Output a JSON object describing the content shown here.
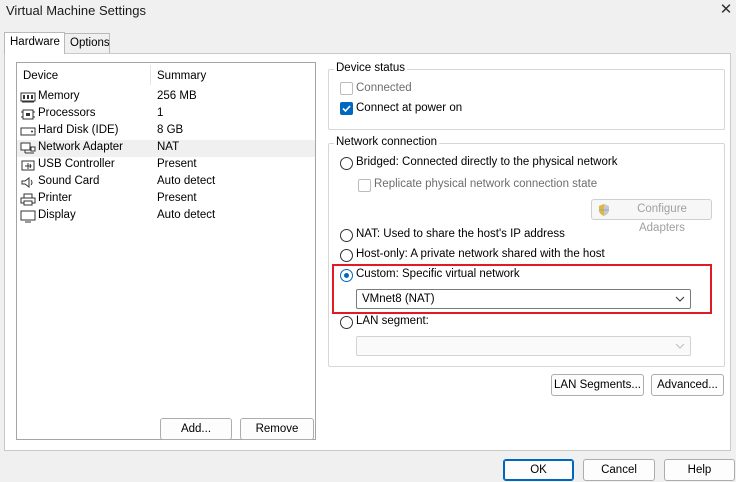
{
  "window": {
    "title": "Virtual Machine Settings"
  },
  "tabs": [
    {
      "label": "Hardware",
      "active": true
    },
    {
      "label": "Options",
      "active": false
    }
  ],
  "device_list": {
    "header_device": "Device",
    "header_summary": "Summary",
    "rows": [
      {
        "name": "Memory",
        "summary": "256 MB",
        "icon": "memory-icon"
      },
      {
        "name": "Processors",
        "summary": "1",
        "icon": "processor-icon"
      },
      {
        "name": "Hard Disk (IDE)",
        "summary": "8 GB",
        "icon": "hard-disk-icon"
      },
      {
        "name": "Network Adapter",
        "summary": "NAT",
        "icon": "network-adapter-icon",
        "selected": true
      },
      {
        "name": "USB Controller",
        "summary": "Present",
        "icon": "usb-icon"
      },
      {
        "name": "Sound Card",
        "summary": "Auto detect",
        "icon": "speaker-icon"
      },
      {
        "name": "Printer",
        "summary": "Present",
        "icon": "printer-icon"
      },
      {
        "name": "Display",
        "summary": "Auto detect",
        "icon": "monitor-icon"
      }
    ],
    "add_label": "Add...",
    "remove_label": "Remove"
  },
  "device_status": {
    "title": "Device status",
    "connected_label": "Connected",
    "connected_checked": false,
    "connect_power_label": "Connect at power on",
    "connect_power_checked": true
  },
  "network_connection": {
    "title": "Network connection",
    "bridged_label": "Bridged: Connected directly to the physical network",
    "replicate_label": "Replicate physical network connection state",
    "configure_label": "Configure Adapters",
    "nat_label": "NAT: Used to share the host's IP address",
    "hostonly_label": "Host-only: A private network shared with the host",
    "custom_label": "Custom: Specific virtual network",
    "custom_selected": true,
    "custom_value": "VMnet8 (NAT)",
    "lan_label": "LAN segment:",
    "lan_value": ""
  },
  "lan_segments_label": "LAN Segments...",
  "advanced_label": "Advanced...",
  "footer": {
    "ok_label": "OK",
    "cancel_label": "Cancel",
    "help_label": "Help"
  },
  "colors": {
    "accent": "#0067c0",
    "highlight": "#e11b22"
  }
}
